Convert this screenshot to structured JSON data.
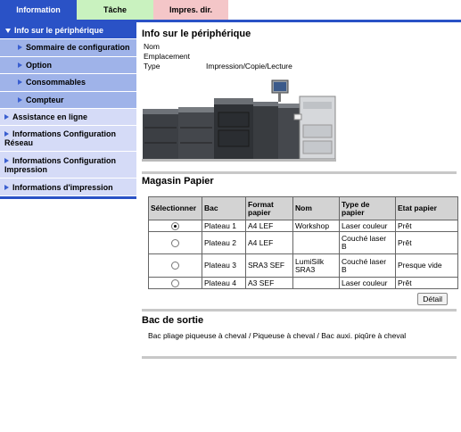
{
  "tabs": [
    {
      "label": "Information"
    },
    {
      "label": "Tâche"
    },
    {
      "label": "Impres. dir."
    }
  ],
  "sidebar": {
    "header": "Info sur le périphérique",
    "subitems": [
      {
        "label": "Sommaire de configuration"
      },
      {
        "label": "Option"
      },
      {
        "label": "Consommables"
      },
      {
        "label": "Compteur"
      }
    ],
    "items": [
      {
        "label": "Assistance en ligne"
      },
      {
        "label": "Informations Configuration Réseau"
      },
      {
        "label": "Informations Configuration Impression"
      },
      {
        "label": "Informations d'impression"
      }
    ]
  },
  "device_info": {
    "title": "Info sur le périphérique",
    "rows": [
      {
        "key": "Nom",
        "value": ""
      },
      {
        "key": "Emplacement",
        "value": ""
      },
      {
        "key": "Type",
        "value": "Impression/Copie/Lecture"
      }
    ]
  },
  "paper": {
    "title": "Magasin Papier",
    "headers": [
      "Sélectionner",
      "Bac",
      "Format papier",
      "Nom",
      "Type de papier",
      "Etat papier"
    ],
    "rows": [
      {
        "selected": true,
        "bac": "Plateau 1",
        "format": "A4 LEF",
        "nom": "Workshop",
        "type": "Laser couleur",
        "etat": "Prêt"
      },
      {
        "selected": false,
        "bac": "Plateau 2",
        "format": "A4 LEF",
        "nom": "",
        "type": "Couché laser B",
        "etat": "Prêt"
      },
      {
        "selected": false,
        "bac": "Plateau 3",
        "format": "SRA3 SEF",
        "nom": "LumiSilk SRA3",
        "type": "Couché laser B",
        "etat": "Presque vide"
      },
      {
        "selected": false,
        "bac": "Plateau 4",
        "format": "A3 SEF",
        "nom": "",
        "type": "Laser couleur",
        "etat": "Prêt"
      }
    ],
    "detail_label": "Détail"
  },
  "output": {
    "title": "Bac de sortie",
    "text": "Bac pliage piqueuse à cheval / Piqueuse à cheval / Bac auxi. piqûre à cheval"
  },
  "colors": {
    "accent": "#2a52c6",
    "tab_tache": "#c9f2bf",
    "tab_impres": "#f4c6c8",
    "sidebar_sub": "#9fb3e9",
    "sidebar_item": "#d5dbf7"
  }
}
